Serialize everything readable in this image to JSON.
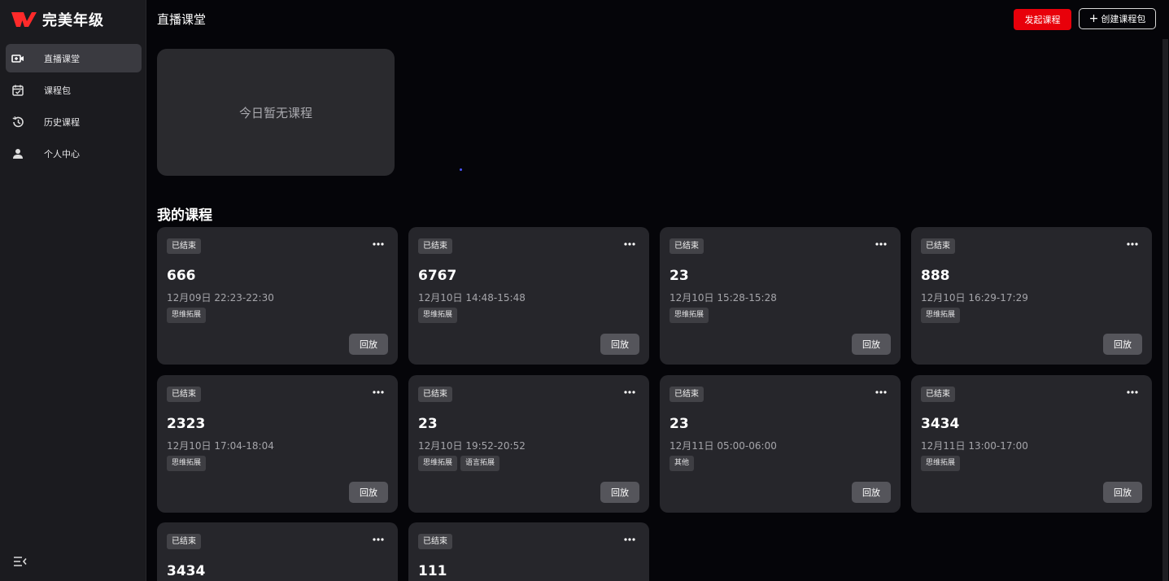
{
  "app": {
    "logo_text": "完美年级",
    "brand_color": "#e8000a"
  },
  "sidebar": {
    "items": [
      {
        "label": "直播课堂",
        "icon": "video-camera-icon",
        "active": true
      },
      {
        "label": "课程包",
        "icon": "calendar-check-icon",
        "active": false
      },
      {
        "label": "历史课程",
        "icon": "history-icon",
        "active": false
      },
      {
        "label": "个人中心",
        "icon": "user-icon",
        "active": false
      }
    ],
    "collapse_icon": "collapse-menu-icon"
  },
  "header": {
    "title": "直播课堂",
    "start_button": "发起课程",
    "create_button": "创建课程包"
  },
  "today": {
    "empty_text": "今日暂无课程"
  },
  "my_courses": {
    "title": "我的课程",
    "replay_label": "回放",
    "items": [
      {
        "status": "已结束",
        "title": "666",
        "time": "12月09日 22:23-22:30",
        "tags": [
          "思维拓展"
        ]
      },
      {
        "status": "已结束",
        "title": "6767",
        "time": "12月10日 14:48-15:48",
        "tags": [
          "思维拓展"
        ]
      },
      {
        "status": "已结束",
        "title": "23",
        "time": "12月10日 15:28-15:28",
        "tags": [
          "思维拓展"
        ]
      },
      {
        "status": "已结束",
        "title": "888",
        "time": "12月10日 16:29-17:29",
        "tags": [
          "思维拓展"
        ]
      },
      {
        "status": "已结束",
        "title": "2323",
        "time": "12月10日 17:04-18:04",
        "tags": [
          "思维拓展"
        ]
      },
      {
        "status": "已结束",
        "title": "23",
        "time": "12月10日 19:52-20:52",
        "tags": [
          "思维拓展",
          "语言拓展"
        ]
      },
      {
        "status": "已结束",
        "title": "23",
        "time": "12月11日 05:00-06:00",
        "tags": [
          "其他"
        ]
      },
      {
        "status": "已结束",
        "title": "3434",
        "time": "12月11日 13:00-17:00",
        "tags": [
          "思维拓展"
        ]
      },
      {
        "status": "已结束",
        "title": "3434",
        "time": "",
        "tags": []
      },
      {
        "status": "已结束",
        "title": "111",
        "time": "",
        "tags": []
      }
    ]
  }
}
